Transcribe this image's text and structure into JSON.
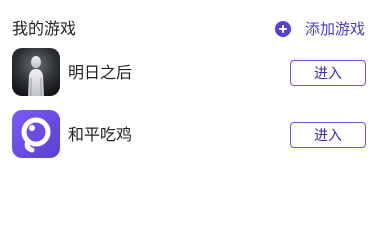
{
  "header": {
    "title": "我的游戏",
    "add_label": "添加游戏"
  },
  "colors": {
    "accent": "#5a3fd6",
    "button_border": "#6a4fd8",
    "button_text": "#3a2fb0"
  },
  "games": [
    {
      "name": "明日之后",
      "icon": "silhouette-game-icon",
      "enter_label": "进入"
    },
    {
      "name": "和平吃鸡",
      "icon": "pin-ring-game-icon",
      "enter_label": "进入"
    }
  ]
}
